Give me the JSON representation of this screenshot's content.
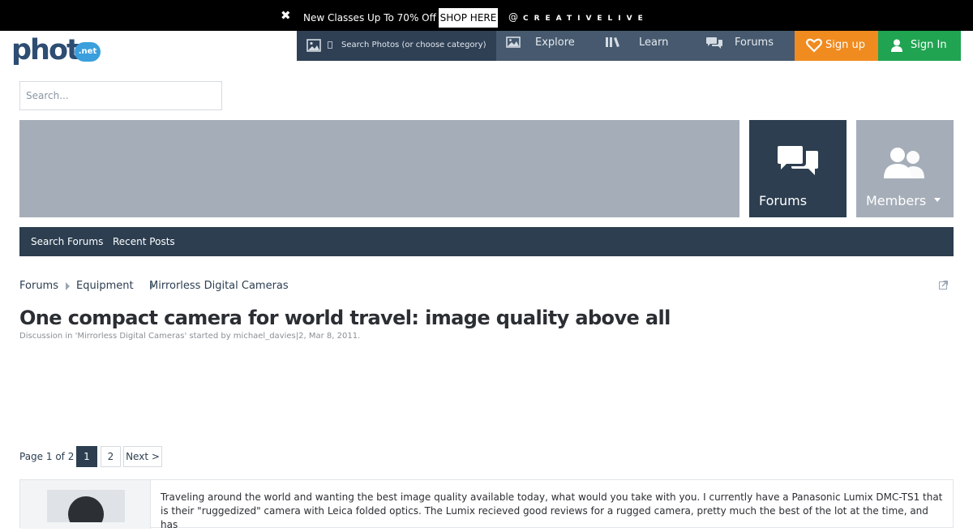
{
  "promo": {
    "close_glyph": "✖",
    "message": "New Classes Up To 70% Off",
    "shop_label": "SHOP HERE",
    "at": "@",
    "brand": "CREATIVELIVE"
  },
  "logo": {
    "text": "photo",
    "badge": ".net"
  },
  "topnav": {
    "search_placeholder": "Search Photos (or choose category)",
    "explore": "Explore",
    "learn": "Learn",
    "forums": "Forums",
    "signup": "Sign up",
    "signin": "Sign In"
  },
  "site_search": {
    "placeholder": "Search..."
  },
  "tiles": {
    "forums": "Forums",
    "members": "Members"
  },
  "tabs": {
    "search_forums": "Search Forums",
    "recent_posts": "Recent Posts"
  },
  "breadcrumb": [
    "Forums",
    "Equipment",
    "Mirrorless Digital Cameras"
  ],
  "thread": {
    "title": "One compact camera for world travel: image quality above all",
    "meta": "Discussion in 'Mirrorless Digital Cameras' started by michael_davies|2, Mar 8, 2011."
  },
  "pagination": {
    "label": "Page 1 of 2",
    "pages": [
      "1",
      "2"
    ],
    "next": "Next >"
  },
  "post": {
    "text": "Traveling around the world and wanting the best image quality available today, what would you take with you. I currently have a Panasonic Lumix DMC-TS1 that is their \"ruggedized\" camera with Leica folded optics. The Lumix recieved good reviews for a rugged camera, pretty much the best of the lot at the time, and has"
  },
  "colors": {
    "navy": "#2c3e50",
    "nav": "#46596e",
    "signup": "#f08b1f",
    "signin": "#20a452",
    "banner": "#a5adb8",
    "logo": "#2d4d73",
    "logo_badge": "#3a9fdc"
  },
  "icons": [
    "close-icon",
    "image-icon",
    "picture-icon",
    "books-icon",
    "chat-bubbles-icon",
    "heart-icon",
    "person-icon",
    "members-icon",
    "external-link-icon"
  ]
}
